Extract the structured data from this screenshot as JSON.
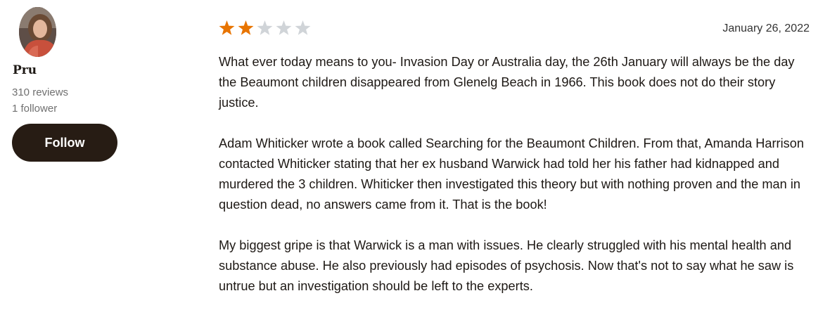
{
  "reviewer": {
    "name": "Pru",
    "reviews_count": "310 reviews",
    "followers_count": "1 follower",
    "follow_label": "Follow"
  },
  "review": {
    "rating": 2,
    "max_rating": 5,
    "date": "January 26, 2022",
    "paragraphs": [
      "What ever today means to you- Invasion Day or Australia day, the 26th January will always be the day the Beaumont children disappeared from Glenelg Beach in 1966. This book does not do their story justice.",
      "Adam Whiticker wrote a book called Searching for the Beaumont Children. From that, Amanda Harrison contacted Whiticker stating that her ex husband Warwick had told her his father had kidnapped and murdered the 3 children. Whiticker then investigated this theory but with nothing proven and the man in question dead, no answers came from it. That is the book!",
      "My biggest gripe is that Warwick is a man with issues. He clearly struggled with his mental health and substance abuse. He also previously had episodes of psychosis. Now that's not to say what he saw is untrue but an investigation should be left to the experts."
    ]
  },
  "colors": {
    "star_filled": "#e87400",
    "star_empty": "#d0d4d8",
    "follow_bg": "#271c14"
  },
  "icons": {
    "star": "star-icon",
    "avatar": "reviewer-avatar-photo"
  }
}
